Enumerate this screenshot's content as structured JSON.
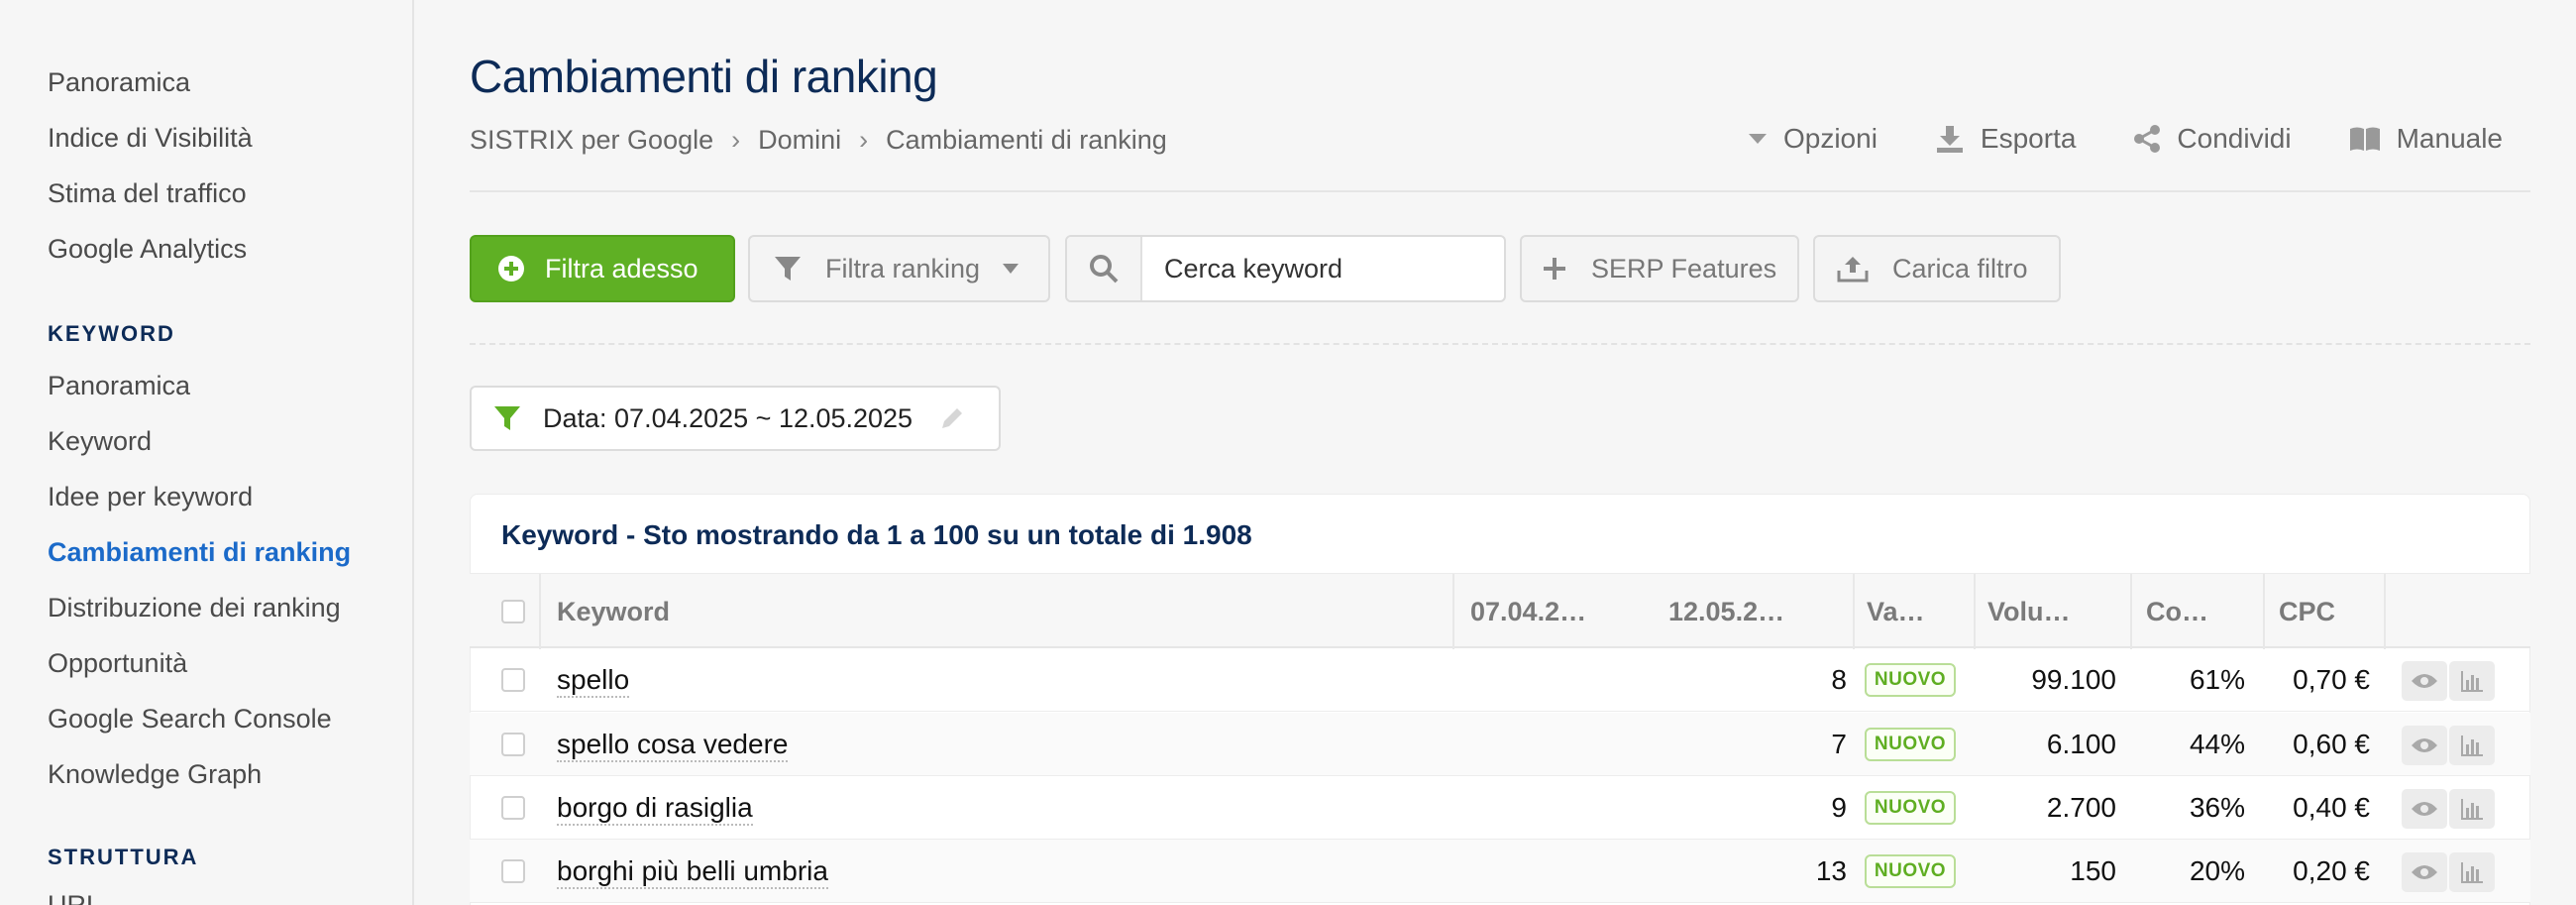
{
  "sidebar": {
    "items_top": [
      "Panoramica",
      "Indice di Visibilità",
      "Stima del traffico",
      "Google Analytics"
    ],
    "section_keyword": "KEYWORD",
    "items_keyword": [
      "Panoramica",
      "Keyword",
      "Idee per keyword",
      "Cambiamenti di ranking",
      "Distribuzione dei ranking",
      "Opportunità",
      "Google Search Console",
      "Knowledge Graph"
    ],
    "active_item": "Cambiamenti di ranking",
    "section_struttura": "STRUTTURA",
    "item_struttura_0": "URL"
  },
  "header": {
    "title": "Cambiamenti di ranking",
    "breadcrumb": [
      "SISTRIX per Google",
      "Domini",
      "Cambiamenti di ranking"
    ],
    "breadcrumb_sep": "›",
    "actions": {
      "opzioni": "Opzioni",
      "esporta": "Esporta",
      "condividi": "Condividi",
      "manuale": "Manuale"
    }
  },
  "toolbar": {
    "filtra_adesso": "Filtra adesso",
    "filtra_ranking": "Filtra ranking",
    "search_value": "Cerca keyword",
    "serp_features": "SERP Features",
    "carica_filtro": "Carica filtro"
  },
  "filter_chip": {
    "label": "Data: 07.04.2025 ~ 12.05.2025"
  },
  "table": {
    "title": "Keyword - Sto mostrando da 1 a 100 su un totale di 1.908",
    "columns": [
      "Keyword",
      "07.04.2…",
      "12.05.2…",
      "Va…",
      "Volu…",
      "Co…",
      "CPC"
    ],
    "rows": [
      {
        "keyword": "spello",
        "old": "",
        "new": "8",
        "change": "NUOVO",
        "volume": "99.100",
        "competition": "61%",
        "cpc": "0,70 €"
      },
      {
        "keyword": "spello cosa vedere",
        "old": "",
        "new": "7",
        "change": "NUOVO",
        "volume": "6.100",
        "competition": "44%",
        "cpc": "0,60 €"
      },
      {
        "keyword": "borgo di rasiglia",
        "old": "",
        "new": "9",
        "change": "NUOVO",
        "volume": "2.700",
        "competition": "36%",
        "cpc": "0,40 €"
      },
      {
        "keyword": "borghi più belli umbria",
        "old": "",
        "new": "13",
        "change": "NUOVO",
        "volume": "150",
        "competition": "20%",
        "cpc": "0,20 €"
      }
    ]
  },
  "colors": {
    "primary_green": "#5fb024",
    "title_navy": "#0d2b57",
    "active_blue": "#1b6ac9"
  }
}
